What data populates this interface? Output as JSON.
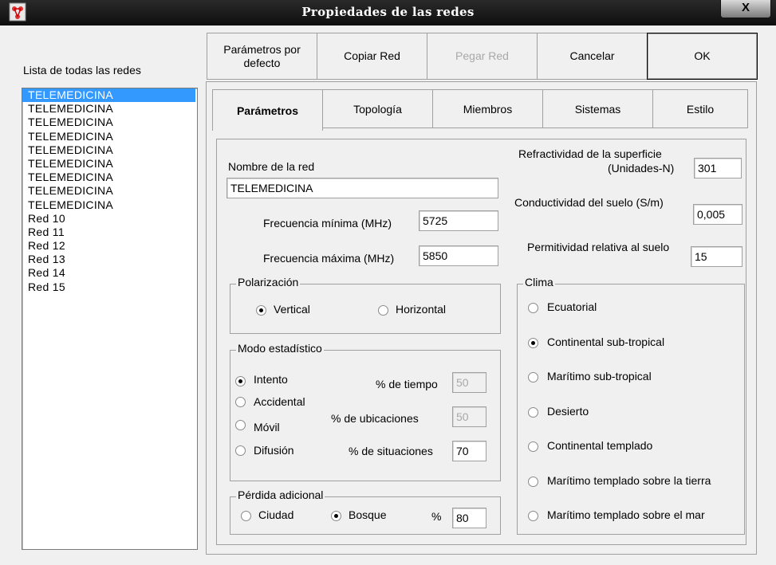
{
  "window": {
    "title": "Propiedades de las redes",
    "close_label": "X"
  },
  "network_list": {
    "label": "Lista de todas las redes",
    "items": [
      "TELEMEDICINA",
      "TELEMEDICINA",
      "TELEMEDICINA",
      "TELEMEDICINA",
      "TELEMEDICINA",
      "TELEMEDICINA",
      "TELEMEDICINA",
      "TELEMEDICINA",
      "TELEMEDICINA",
      "Red 10",
      "Red 11",
      "Red 12",
      "Red 13",
      "Red 14",
      "Red 15"
    ],
    "selected_index": 0
  },
  "toolbar": {
    "defaults_line1": "Parámetros por",
    "defaults_line2": "defecto",
    "copy": "Copiar Red",
    "paste": "Pegar Red",
    "cancel": "Cancelar",
    "ok": "OK"
  },
  "tabs": [
    "Parámetros",
    "Topología",
    "Miembros",
    "Sistemas",
    "Estilo"
  ],
  "active_tab": "Parámetros",
  "parameters": {
    "network_name_label": "Nombre de la red",
    "network_name": "TELEMEDICINA",
    "min_freq_label": "Frecuencia mínima (MHz)",
    "min_freq": "5725",
    "max_freq_label": "Frecuencia máxima (MHz)",
    "max_freq": "5850",
    "refractivity_label_1": "Refractividad de la superficie",
    "refractivity_label_2": "(Unidades-N)",
    "refractivity": "301",
    "conductivity_label": "Conductividad del suelo (S/m)",
    "conductivity": "0,005",
    "permittivity_label": "Permitividad relativa al suelo",
    "permittivity": "15"
  },
  "polarization": {
    "legend": "Polarización",
    "vertical": "Vertical",
    "horizontal": "Horizontal",
    "selected": "Vertical"
  },
  "statistical_mode": {
    "legend": "Modo estadístico",
    "options": [
      "Intento",
      "Accidental",
      "Móvil",
      "Difusión"
    ],
    "selected": "Intento",
    "time_label": "% de tiempo",
    "time": "50",
    "locations_label": "% de ubicaciones",
    "locations": "50",
    "situations_label": "% de situaciones",
    "situations": "70"
  },
  "additional_loss": {
    "legend": "Pérdida adicional",
    "city": "Ciudad",
    "forest": "Bosque",
    "selected": "Bosque",
    "percent_label": "%",
    "percent": "80"
  },
  "climate": {
    "legend": "Clima",
    "options": [
      "Ecuatorial",
      "Continental sub-tropical",
      "Marítimo sub-tropical",
      "Desierto",
      "Continental templado",
      "Marítimo templado sobre la tierra",
      "Marítimo templado sobre el mar"
    ],
    "selected": "Continental sub-tropical"
  }
}
